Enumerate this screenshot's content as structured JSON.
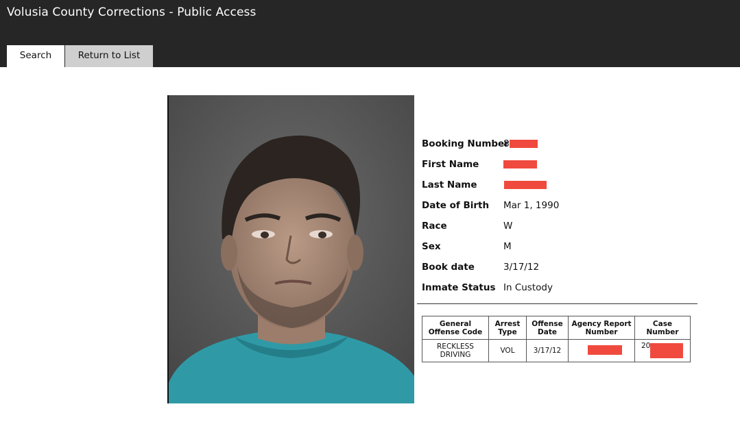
{
  "header": {
    "title": "Volusia County Corrections - Public Access"
  },
  "tabs": [
    {
      "label": "Search",
      "active": true
    },
    {
      "label": "Return to List",
      "active": false
    }
  ],
  "details": {
    "booking_number": {
      "label": "Booking Number",
      "value": "8"
    },
    "first_name": {
      "label": "First Name",
      "value": ""
    },
    "last_name": {
      "label": "Last Name",
      "value": ""
    },
    "dob": {
      "label": "Date of Birth",
      "value": "Mar 1, 1990"
    },
    "race": {
      "label": "Race",
      "value": "W"
    },
    "sex": {
      "label": "Sex",
      "value": "M"
    },
    "book_date": {
      "label": "Book date",
      "value": "3/17/12"
    },
    "status": {
      "label": "Inmate Status",
      "value": "In Custody"
    }
  },
  "offenses": {
    "headers": [
      "General Offense Code",
      "Arrest Type",
      "Offense Date",
      "Agency Report Number",
      "Case Number"
    ],
    "rows": [
      {
        "offense_code": "RECKLESS DRIVING",
        "arrest_type": "VOL",
        "offense_date": "3/17/12",
        "agency_report": "",
        "case_number": "20"
      }
    ]
  },
  "colors": {
    "header_bg": "#262626",
    "redaction": "#f04a3e",
    "photo_bg": "#5a5a5a",
    "shirt": "#2f9aa6"
  }
}
